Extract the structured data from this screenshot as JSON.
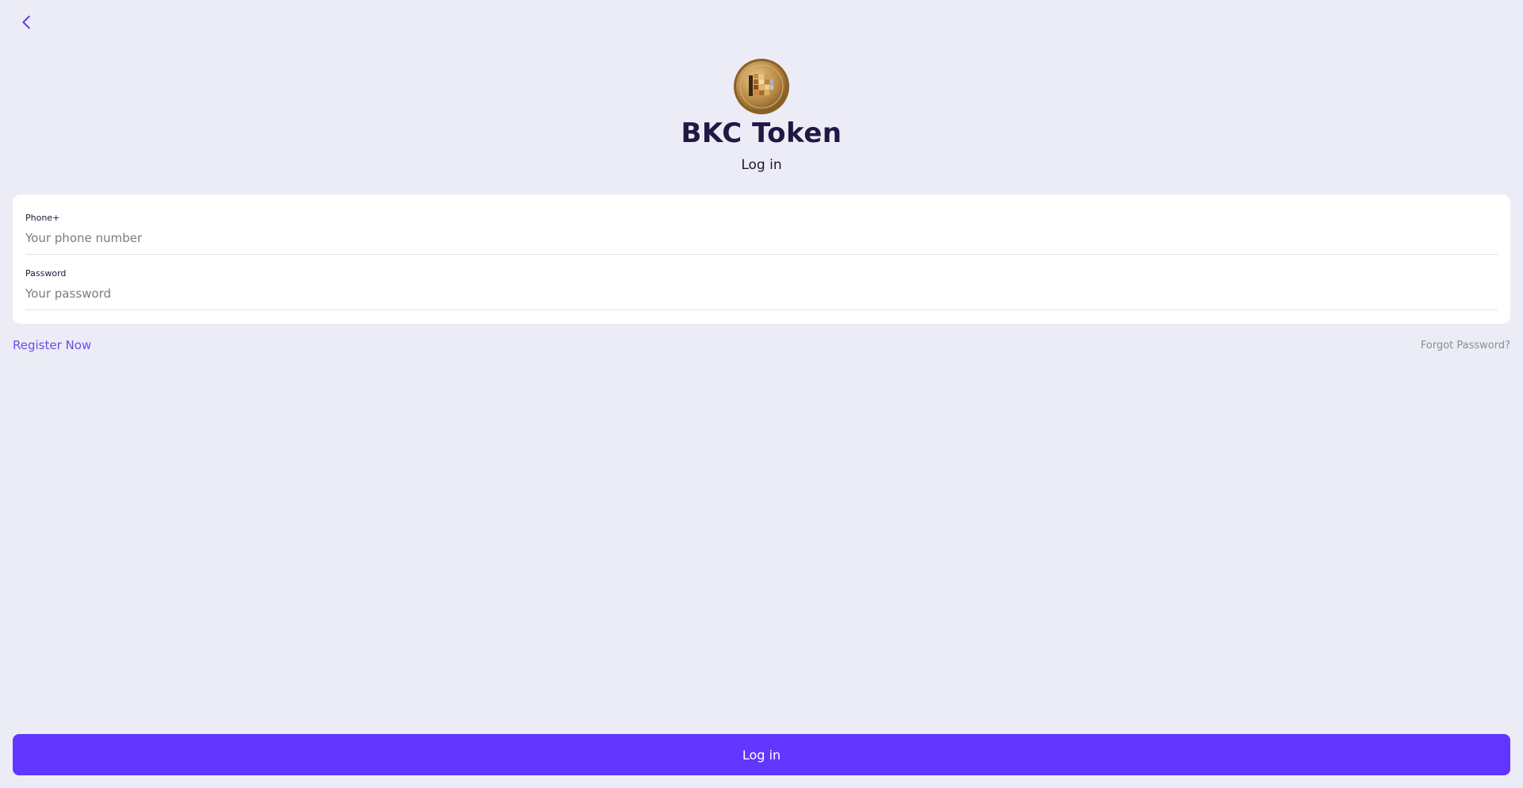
{
  "header": {
    "back_icon": "chevron-left-icon",
    "logo_icon": "bkc-token-coin-logo",
    "title": "BKC Token",
    "subtitle": "Log in"
  },
  "form": {
    "phone": {
      "label": "Phone+",
      "value": "",
      "placeholder": "Your phone number"
    },
    "password": {
      "label": "Password",
      "value": "",
      "placeholder": "Your password"
    }
  },
  "links": {
    "register": "Register Now",
    "forgot": "Forgot Password?"
  },
  "actions": {
    "login_label": "Log in"
  },
  "colors": {
    "background": "#ececf6",
    "accent": "#6236ff",
    "link": "#6a4ce8",
    "muted": "#8d8d96",
    "title": "#211843"
  }
}
